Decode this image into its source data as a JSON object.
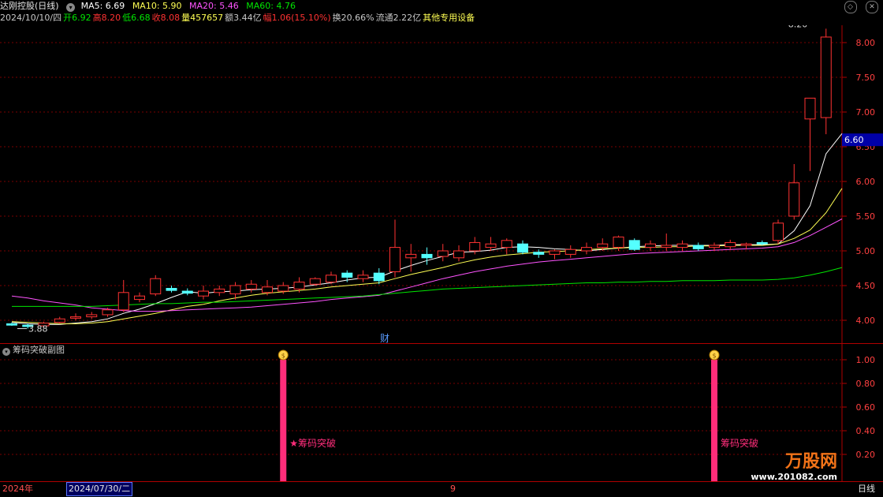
{
  "header": {
    "stock_name": "达刚控股",
    "period": "(日线)",
    "ma5": "MA5: 6.69",
    "ma10": "MA10: 5.90",
    "ma20": "MA20: 5.46",
    "ma60": "MA60: 4.76",
    "date": "2024/10/10/四",
    "open": "开6.92",
    "high": "高8.20",
    "low": "低6.68",
    "close": "收8.08",
    "volume": "量457657",
    "amount": "额3.44亿",
    "change": "幅1.06(15.10%)",
    "turnover": "换20.66%",
    "float_cap": "流通2.22亿",
    "sector": "其他专用设备"
  },
  "colors": {
    "up": "#ff3232",
    "down": "#54ffff",
    "ma5": "#ffffff",
    "ma10": "#ffff54",
    "ma20": "#ff54ff",
    "ma60": "#00e600",
    "axis": "#b00000",
    "signal": "#ff2d7a"
  },
  "main_chart": {
    "high_label": "8.20",
    "low_label": "3.88",
    "current_price": "6.60",
    "finance_marker": "财"
  },
  "sub_chart": {
    "title": "筹码突破副图",
    "signal_label": "★筹码突破",
    "signal_label2": "筹码突破"
  },
  "bottom_bar": {
    "year": "2024年",
    "date_box": "2024/07/30/二",
    "month_marker": "9",
    "period_label": "日线"
  },
  "watermark": {
    "brand": "万股网",
    "url": "www.201082.com"
  },
  "chart_data": [
    {
      "type": "candlestick",
      "name": "daily",
      "ylim": [
        3.8,
        8.25
      ],
      "y_ticks": [
        "8.00",
        "7.50",
        "7.00",
        "6.50",
        "6.00",
        "5.50",
        "5.00",
        "4.50",
        "4.00"
      ],
      "candles": [
        [
          3.95,
          3.97,
          3.92,
          3.93
        ],
        [
          3.93,
          3.95,
          3.88,
          3.91
        ],
        [
          3.92,
          3.98,
          3.9,
          3.96
        ],
        [
          3.97,
          4.05,
          3.95,
          4.02
        ],
        [
          4.03,
          4.1,
          4.0,
          4.05
        ],
        [
          4.05,
          4.12,
          4.02,
          4.08
        ],
        [
          4.08,
          4.18,
          4.05,
          4.15
        ],
        [
          4.15,
          4.58,
          4.12,
          4.4
        ],
        [
          4.3,
          4.4,
          4.26,
          4.35
        ],
        [
          4.38,
          4.65,
          4.35,
          4.6
        ],
        [
          4.46,
          4.5,
          4.4,
          4.43
        ],
        [
          4.42,
          4.46,
          4.36,
          4.39
        ],
        [
          4.35,
          4.5,
          4.3,
          4.42
        ],
        [
          4.4,
          4.5,
          4.35,
          4.45
        ],
        [
          4.38,
          4.55,
          4.3,
          4.5
        ],
        [
          4.45,
          4.58,
          4.4,
          4.52
        ],
        [
          4.4,
          4.58,
          4.36,
          4.48
        ],
        [
          4.42,
          4.55,
          4.38,
          4.5
        ],
        [
          4.45,
          4.62,
          4.4,
          4.55
        ],
        [
          4.52,
          4.62,
          4.5,
          4.6
        ],
        [
          4.55,
          4.7,
          4.52,
          4.65
        ],
        [
          4.68,
          4.72,
          4.55,
          4.62
        ],
        [
          4.6,
          4.72,
          4.55,
          4.65
        ],
        [
          4.68,
          4.75,
          4.52,
          4.57
        ],
        [
          4.7,
          5.45,
          4.62,
          5.05
        ],
        [
          4.9,
          5.1,
          4.7,
          4.95
        ],
        [
          4.95,
          5.05,
          4.8,
          4.9
        ],
        [
          4.92,
          5.1,
          4.85,
          5.0
        ],
        [
          4.9,
          5.08,
          4.85,
          5.0
        ],
        [
          5.0,
          5.2,
          4.95,
          5.12
        ],
        [
          5.05,
          5.2,
          5.0,
          5.1
        ],
        [
          5.05,
          5.18,
          4.95,
          5.15
        ],
        [
          5.1,
          5.15,
          4.95,
          4.98
        ],
        [
          4.98,
          5.02,
          4.9,
          4.95
        ],
        [
          4.95,
          5.02,
          4.88,
          5.0
        ],
        [
          4.95,
          5.08,
          4.9,
          5.02
        ],
        [
          5.0,
          5.12,
          4.95,
          5.05
        ],
        [
          5.05,
          5.18,
          5.0,
          5.1
        ],
        [
          5.05,
          5.22,
          5.0,
          5.2
        ],
        [
          5.15,
          5.18,
          5.0,
          5.02
        ],
        [
          5.05,
          5.15,
          5.0,
          5.1
        ],
        [
          5.05,
          5.25,
          5.0,
          5.08
        ],
        [
          5.05,
          5.15,
          5.0,
          5.1
        ],
        [
          5.08,
          5.12,
          5.0,
          5.03
        ],
        [
          5.05,
          5.12,
          5.0,
          5.08
        ],
        [
          5.06,
          5.16,
          5.02,
          5.12
        ],
        [
          5.08,
          5.12,
          5.02,
          5.1
        ],
        [
          5.12,
          5.15,
          5.08,
          5.1
        ],
        [
          5.15,
          5.45,
          5.1,
          5.4
        ],
        [
          5.5,
          6.25,
          5.45,
          5.98
        ],
        [
          6.9,
          7.1,
          6.15,
          7.2
        ],
        [
          6.92,
          8.2,
          6.68,
          8.08
        ]
      ],
      "series": [
        {
          "name": "MA5",
          "values": [
            3.97,
            3.95,
            3.94,
            3.94,
            3.96,
            3.98,
            4.02,
            4.1,
            4.16,
            4.24,
            4.33,
            4.41,
            4.39,
            4.41,
            4.42,
            4.44,
            4.45,
            4.46,
            4.48,
            4.51,
            4.54,
            4.58,
            4.61,
            4.62,
            4.71,
            4.79,
            4.86,
            4.92,
            4.98,
            4.99,
            5.01,
            5.05,
            5.06,
            5.05,
            5.03,
            5.02,
            5.0,
            5.02,
            5.04,
            5.06,
            5.07,
            5.08,
            5.08,
            5.08,
            5.08,
            5.09,
            5.09,
            5.09,
            5.1,
            5.29,
            5.65,
            6.4,
            6.69
          ]
        },
        {
          "name": "MA10",
          "values": [
            3.98,
            3.97,
            3.96,
            3.95,
            3.95,
            3.96,
            3.98,
            4.02,
            4.06,
            4.1,
            4.15,
            4.2,
            4.23,
            4.28,
            4.32,
            4.36,
            4.39,
            4.41,
            4.43,
            4.45,
            4.48,
            4.5,
            4.52,
            4.54,
            4.6,
            4.66,
            4.71,
            4.76,
            4.82,
            4.87,
            4.91,
            4.94,
            4.96,
            4.98,
            4.99,
            5.0,
            5.02,
            5.03,
            5.04,
            5.05,
            5.05,
            5.06,
            5.06,
            5.07,
            5.07,
            5.08,
            5.08,
            5.08,
            5.1,
            5.18,
            5.3,
            5.55,
            5.9
          ]
        },
        {
          "name": "MA20",
          "values": [
            4.35,
            4.32,
            4.28,
            4.25,
            4.22,
            4.18,
            4.16,
            4.14,
            4.13,
            4.13,
            4.14,
            4.15,
            4.16,
            4.17,
            4.18,
            4.19,
            4.21,
            4.23,
            4.25,
            4.27,
            4.3,
            4.32,
            4.34,
            4.36,
            4.42,
            4.48,
            4.54,
            4.6,
            4.65,
            4.7,
            4.74,
            4.78,
            4.81,
            4.84,
            4.86,
            4.88,
            4.9,
            4.92,
            4.94,
            4.96,
            4.97,
            4.98,
            4.99,
            5.0,
            5.01,
            5.02,
            5.03,
            5.04,
            5.06,
            5.12,
            5.22,
            5.34,
            5.46
          ]
        },
        {
          "name": "MA60",
          "values": [
            4.2,
            4.2,
            4.2,
            4.2,
            4.2,
            4.2,
            4.21,
            4.22,
            4.23,
            4.24,
            4.24,
            4.25,
            4.26,
            4.26,
            4.27,
            4.28,
            4.29,
            4.3,
            4.31,
            4.32,
            4.33,
            4.34,
            4.35,
            4.37,
            4.39,
            4.41,
            4.43,
            4.45,
            4.46,
            4.47,
            4.48,
            4.49,
            4.5,
            4.51,
            4.52,
            4.53,
            4.54,
            4.54,
            4.55,
            4.55,
            4.56,
            4.56,
            4.57,
            4.57,
            4.57,
            4.58,
            4.58,
            4.58,
            4.59,
            4.61,
            4.65,
            4.7,
            4.76
          ]
        }
      ]
    },
    {
      "type": "bar",
      "name": "筹码突破副图",
      "ylim": [
        0,
        1.05
      ],
      "y_ticks": [
        "1.00",
        "0.80",
        "0.60",
        "0.40",
        "0.20"
      ],
      "signals": [
        {
          "index": 17,
          "value": 1.0
        },
        {
          "index": 44,
          "value": 1.0
        }
      ]
    }
  ]
}
